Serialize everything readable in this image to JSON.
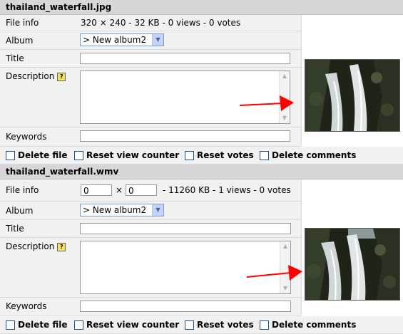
{
  "files": [
    {
      "filename": "thailand_waterfall.jpg",
      "labels": {
        "file_info": "File info",
        "album": "Album",
        "title": "Title",
        "description": "Description",
        "keywords": "Keywords"
      },
      "file_info": "320 × 240 - 32 KB - 0 views - 0 votes",
      "album_selected": "> New album2",
      "title_value": "",
      "description_value": "",
      "keywords_value": "",
      "help_icon": "?",
      "thumbnail_icon": "waterfall-thumbnail",
      "options": [
        "Delete file",
        "Reset view counter",
        "Reset votes",
        "Delete comments"
      ]
    },
    {
      "filename": "thailand_waterfall.wmv",
      "labels": {
        "file_info": "File info",
        "album": "Album",
        "title": "Title",
        "description": "Description",
        "keywords": "Keywords"
      },
      "width_value": "0",
      "times": "×",
      "height_value": "0",
      "file_info": "- 11260 KB - 1 views - 0 votes",
      "album_selected": "> New album2",
      "title_value": "",
      "description_value": "",
      "keywords_value": "",
      "help_icon": "?",
      "thumbnail_icon": "waterfall-thumbnail",
      "options": [
        "Delete file",
        "Reset view counter",
        "Reset votes",
        "Delete comments"
      ]
    }
  ],
  "annotation_color": "#ff0000"
}
